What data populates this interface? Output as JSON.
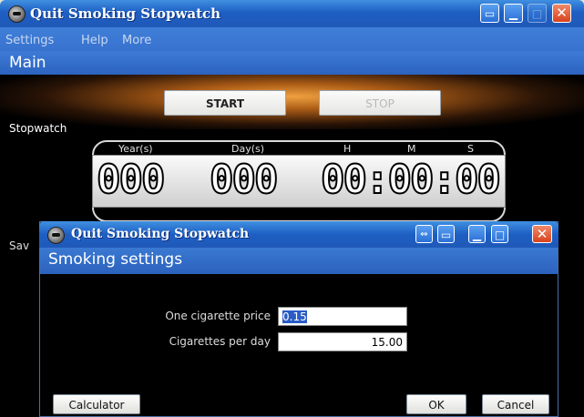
{
  "window": {
    "title": "Quit Smoking Stopwatch",
    "menu": [
      "Settings",
      "Help",
      "More"
    ],
    "section_title": "Main"
  },
  "controls": {
    "start_label": "START",
    "stop_label": "STOP"
  },
  "stopwatch": {
    "label": "Stopwatch",
    "units": [
      "Year(s)",
      "Day(s)",
      "H",
      "M",
      "S"
    ],
    "years": "000",
    "days": "000",
    "time": "00:00:00"
  },
  "partial_label": "Sav",
  "dialog": {
    "title": "Quit Smoking Stopwatch",
    "section_title": "Smoking settings",
    "fields": {
      "price_label": "One cigarette price",
      "price_value": "0.15",
      "cigs_label": "Cigarettes per day",
      "cigs_value": "15.00"
    },
    "buttons": {
      "calculator": "Calculator",
      "ok": "OK",
      "cancel": "Cancel"
    }
  },
  "colors": {
    "titlebar_blue": "#1e5fc3",
    "glow_orange": "#f0a040",
    "close_red": "#d8421c"
  }
}
